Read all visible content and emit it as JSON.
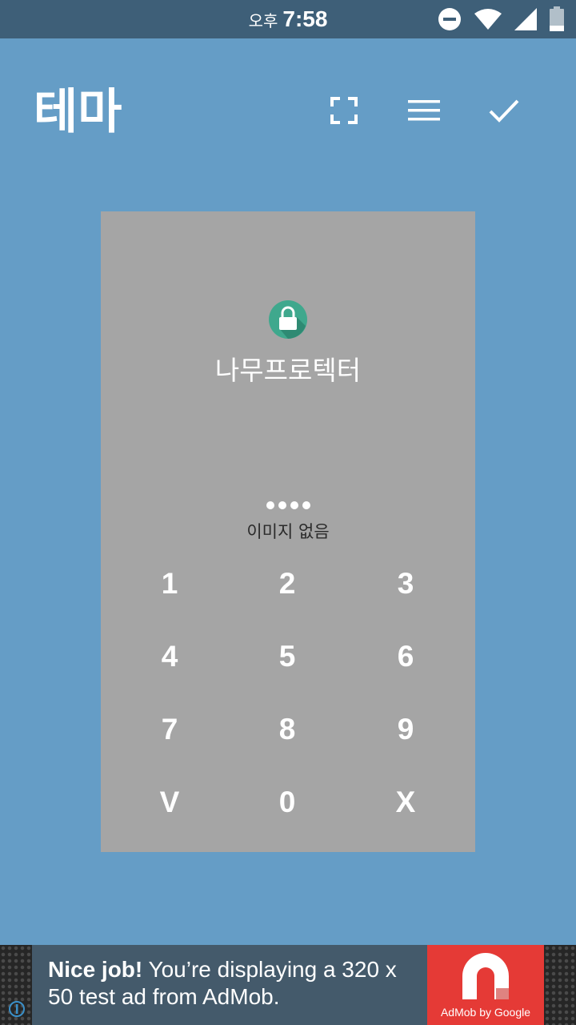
{
  "status_bar": {
    "ampm": "오후",
    "time": "7:58",
    "icons": [
      "do-not-disturb-icon",
      "wifi-icon",
      "signal-icon",
      "battery-icon"
    ]
  },
  "app_bar": {
    "title": "테마",
    "actions": [
      "fullscreen-icon",
      "menu-icon",
      "check-icon"
    ]
  },
  "preview": {
    "app_name": "나무프로텍터",
    "pin_dot_count": 4,
    "message": "이미지 없음",
    "keys": [
      [
        "1",
        "2",
        "3"
      ],
      [
        "4",
        "5",
        "6"
      ],
      [
        "7",
        "8",
        "9"
      ],
      [
        "V",
        "0",
        "X"
      ]
    ]
  },
  "ad": {
    "bold_text": "Nice job!",
    "text": " You’re displaying a 320 x 50 test ad from AdMob.",
    "logo_text": "AdMob by Google"
  },
  "colors": {
    "background": "#659dc6",
    "status_bar": "#3e5f78",
    "preview_bg": "#a5a5a5",
    "lock_badge": "#3fa88d",
    "ad_red": "#e53a36"
  }
}
